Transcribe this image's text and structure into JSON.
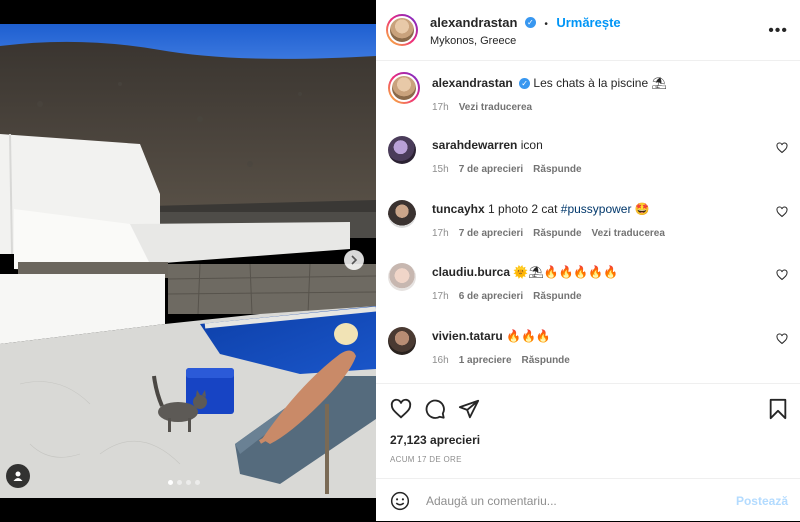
{
  "header": {
    "username": "alexandrastan",
    "follow_label": "Urmărește",
    "location": "Mykonos, Greece",
    "more": "•••"
  },
  "caption": {
    "username": "alexandrastan",
    "text": "Les chats à la piscine ⛱",
    "time": "17h",
    "translate": "Vezi traducerea"
  },
  "comments": [
    {
      "username": "sarahdewarren",
      "text": "icon",
      "time": "15h",
      "likes": "7 de aprecieri",
      "reply": "Răspunde"
    },
    {
      "username": "tuncayhx",
      "text": "1 photo 2 cat ",
      "hashtag": "#pussypower",
      "emoji": "🤩",
      "time": "17h",
      "likes": "7 de aprecieri",
      "reply": "Răspunde",
      "translate": "Vezi traducerea"
    },
    {
      "username": "claudiu.burca",
      "text": "🌞⛱🔥🔥🔥🔥🔥",
      "time": "17h",
      "likes": "6 de aprecieri",
      "reply": "Răspunde"
    },
    {
      "username": "vivien.tataru",
      "text": "🔥🔥🔥",
      "time": "16h",
      "likes": "1 apreciere",
      "reply": "Răspunde"
    }
  ],
  "post": {
    "likes": "27,123 aprecieri",
    "time": "ACUM 17 DE ORE"
  },
  "add_comment": {
    "placeholder": "Adaugă un comentariu...",
    "post_label": "Postează"
  },
  "carousel": {
    "slides": 4,
    "active": 1
  },
  "colors": {
    "accent": "#0095f6",
    "verified": "#3897f0",
    "muted": "#8e8e8e"
  }
}
